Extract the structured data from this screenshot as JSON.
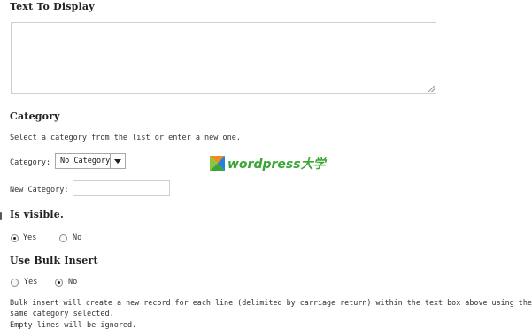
{
  "text_to_display": {
    "heading": "Text To Display",
    "value": ""
  },
  "category": {
    "heading": "Category",
    "instructions": "Select a category from the list or enter a new one.",
    "label": "Category:",
    "selected": "No Category",
    "new_label": "New Category:",
    "new_value": ""
  },
  "visible": {
    "heading": "Is visible.",
    "options": [
      {
        "label": "Yes",
        "checked": true
      },
      {
        "label": "No",
        "checked": false
      }
    ]
  },
  "bulk": {
    "heading": "Use Bulk Insert",
    "options": [
      {
        "label": "Yes",
        "checked": false
      },
      {
        "label": "No",
        "checked": true
      }
    ],
    "help_line1": "Bulk insert will create a new record for each line (delimited by carriage return) within the text box above using the",
    "help_line2": "same category selected.",
    "help_line3": "Empty lines will be ignored."
  },
  "watermark": {
    "text": "wordpress大学",
    "colors": {
      "green": "#3aa635",
      "orange": "#f28b1d",
      "blue": "#2b7fd4",
      "light_green": "#8cc63f"
    }
  }
}
